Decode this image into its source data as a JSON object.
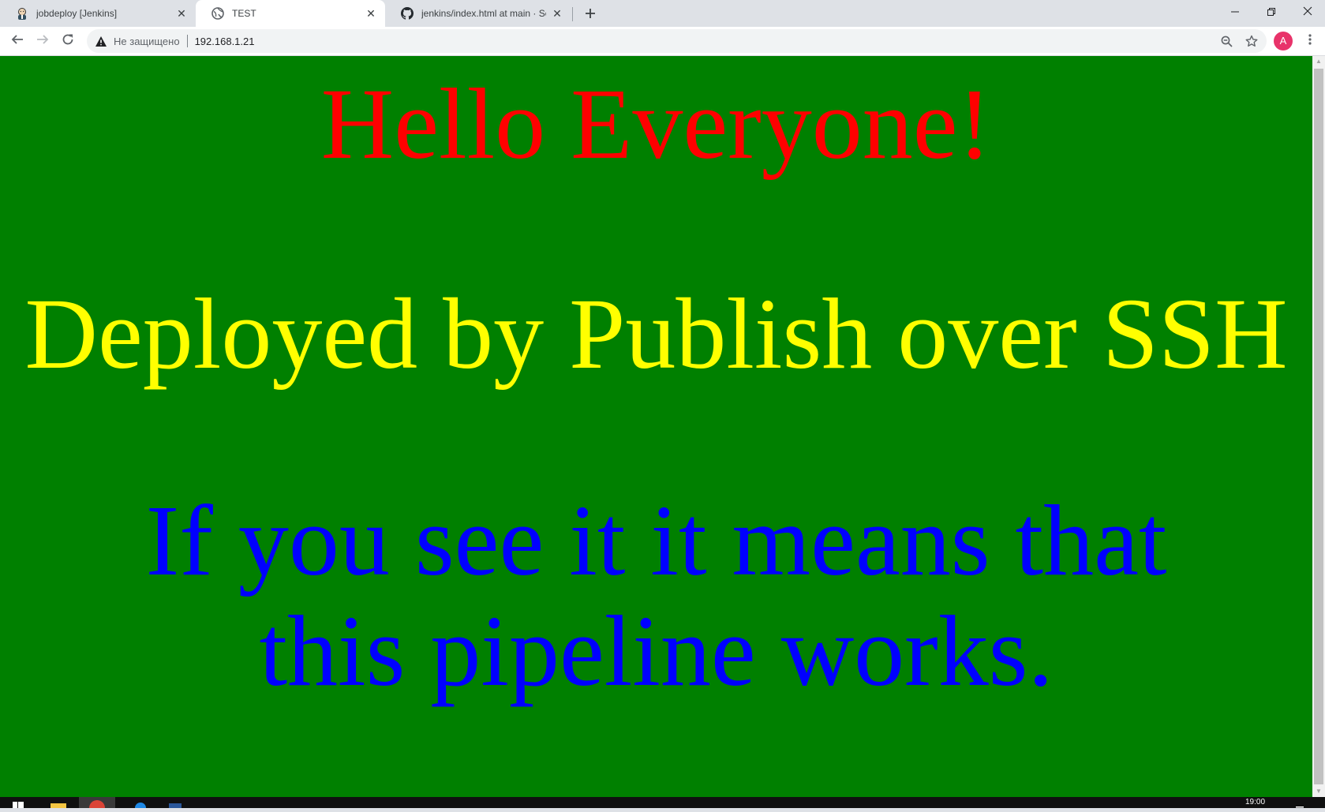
{
  "tabs": [
    {
      "title": "jobdeploy [Jenkins]",
      "icon": "jenkins-butler-icon"
    },
    {
      "title": "TEST",
      "icon": "globe-icon"
    },
    {
      "title": "jenkins/index.html at main · Secre",
      "icon": "github-icon"
    }
  ],
  "active_tab": 1,
  "toolbar": {
    "security_text": "Не защищено",
    "url": "192.168.1.21",
    "avatar_letter": "A"
  },
  "page": {
    "hello_text": "Hello Everyone!",
    "deployed_text": "Deployed by Publish over SSH",
    "works_text": "If you see it it means that this pipeline works.",
    "background_color": "#008000",
    "hello_color": "#ff0000",
    "deployed_color": "#ffff00",
    "works_color": "#0000ff"
  },
  "taskbar": {
    "time": "19:00"
  }
}
